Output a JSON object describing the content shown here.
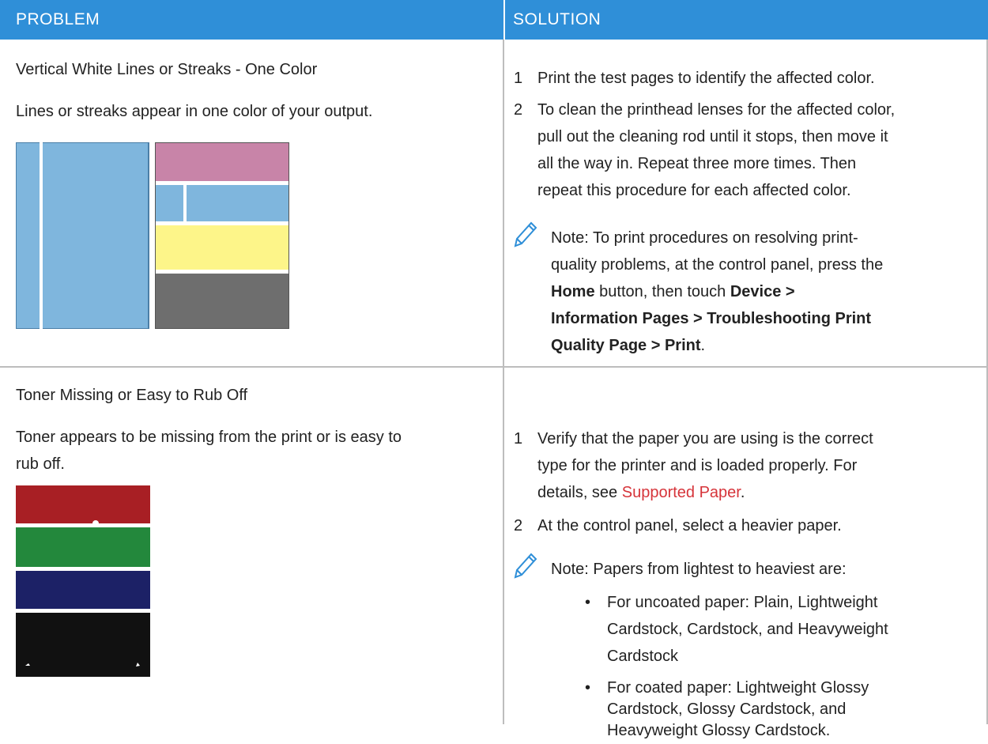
{
  "header": {
    "problem": "PROBLEM",
    "solution": "SOLUTION"
  },
  "row1": {
    "title": "Vertical White Lines or Streaks - One Color",
    "desc": "Lines or streaks appear in one color of your output.",
    "steps": [
      {
        "num": "1",
        "lines": [
          "Print the test pages to identify the affected color."
        ]
      },
      {
        "num": "2",
        "lines": [
          "To clean the printhead lenses for the affected color,",
          "pull out the cleaning rod until it stops, then move it",
          "all the way in. Repeat three more times. Then",
          "repeat this procedure for each affected color."
        ]
      }
    ],
    "note": {
      "l1": "Note: To print procedures on resolving print-",
      "l2": "quality problems, at the control panel, press the",
      "home": "Home",
      "button_then": " button, then touch ",
      "device": "Device >",
      "l4": "Information Pages > Troubleshooting Print",
      "l5": "Quality Page > Print",
      "period": "."
    }
  },
  "row2": {
    "title": "Toner Missing or Easy to Rub Off",
    "desc1": "Toner appears to be missing from the print or is easy to",
    "desc2": "rub off.",
    "step1": {
      "num": "1",
      "l1": "Verify that the paper you are using is the correct",
      "l2": "type for the printer and is loaded properly. For",
      "l3_prefix": "details, see ",
      "link": "Supported Paper",
      "l3_suffix": "."
    },
    "step2": {
      "num": "2",
      "text": "At the control panel, select a heavier paper."
    },
    "note": "Note: Papers from lightest to heaviest are:",
    "bullets": [
      {
        "lines": [
          "For uncoated paper: Plain, Lightweight",
          "Cardstock, Cardstock, and Heavyweight",
          "Cardstock"
        ]
      },
      {
        "lines": [
          "For coated paper: Lightweight Glossy",
          "Cardstock, Glossy Cardstock, and",
          "Heavyweight Glossy Cardstock."
        ]
      }
    ]
  },
  "colors": {
    "header": "#2f8fd8",
    "link": "#d6343a",
    "icon": "#2f8fd8",
    "swatch_blue": "#7fb6dd",
    "swatch_pink": "#c884a8",
    "swatch_yellow": "#fdf589",
    "swatch_gray": "#6e6e6e",
    "toner_red": "#a81f24",
    "toner_green": "#23883c",
    "toner_navy": "#1c2166",
    "toner_black": "#111111"
  }
}
